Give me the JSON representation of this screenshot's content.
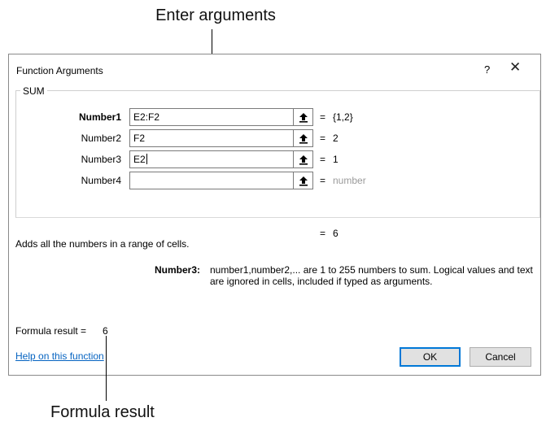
{
  "callouts": {
    "top": "Enter arguments",
    "bottom": "Formula result"
  },
  "dialog": {
    "title": "Function Arguments",
    "help_button": "?",
    "close_button": "✕",
    "function_name": "SUM",
    "arguments": [
      {
        "label": "Number1",
        "bold": true,
        "value": "E2:F2",
        "result": "{1,2}"
      },
      {
        "label": "Number2",
        "bold": false,
        "value": "F2",
        "result": "2"
      },
      {
        "label": "Number3",
        "bold": false,
        "value": "E2",
        "result": "1",
        "focused": true
      },
      {
        "label": "Number4",
        "bold": false,
        "value": "",
        "result": "number",
        "placeholder": true
      }
    ],
    "equals_sign": "=",
    "total_result": "6",
    "description": "Adds all the numbers in a range of cells.",
    "arg_help_name": "Number3:",
    "arg_help_text": "number1,number2,... are 1 to 255 numbers to sum. Logical values and text are ignored in cells, included if typed as arguments.",
    "formula_result_label": "Formula result =",
    "formula_result_value": "6",
    "help_link": "Help on this function",
    "ok_label": "OK",
    "cancel_label": "Cancel"
  },
  "colors": {
    "link": "#0563c1",
    "default_button_border": "#0078d7",
    "placeholder_text": "#9a9a9a"
  }
}
